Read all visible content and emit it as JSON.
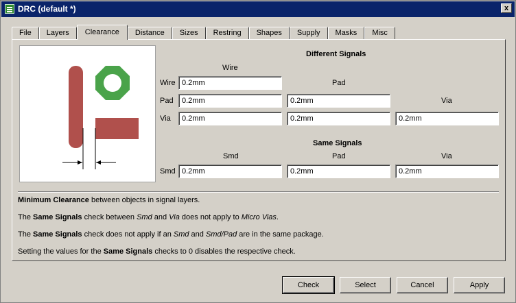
{
  "window": {
    "title": "DRC (default *)",
    "close_symbol": "x"
  },
  "tabs": [
    "File",
    "Layers",
    "Clearance",
    "Distance",
    "Sizes",
    "Restring",
    "Shapes",
    "Supply",
    "Masks",
    "Misc"
  ],
  "active_tab": "Clearance",
  "different_signals": {
    "heading": "Different Signals",
    "col_wire": "Wire",
    "col_pad": "Pad",
    "col_via": "Via",
    "row_wire": "Wire",
    "row_pad": "Pad",
    "row_via": "Via",
    "wire_wire": "0.2mm",
    "pad_wire": "0.2mm",
    "pad_pad": "0.2mm",
    "via_wire": "0.2mm",
    "via_pad": "0.2mm",
    "via_via": "0.2mm"
  },
  "same_signals": {
    "heading": "Same Signals",
    "col_smd": "Smd",
    "col_pad": "Pad",
    "col_via": "Via",
    "row_smd": "Smd",
    "smd_smd": "0.2mm",
    "smd_pad": "0.2mm",
    "smd_via": "0.2mm"
  },
  "description": {
    "line1_b": "Minimum Clearance",
    "line1_t": " between objects in signal layers.",
    "line2_a": "The ",
    "line2_b": "Same Signals",
    "line2_c": " check between ",
    "line2_i1": "Smd",
    "line2_d": " and ",
    "line2_i2": "Via",
    "line2_e": " does not apply to ",
    "line2_i3": "Micro Vias",
    "line2_f": ".",
    "line3_a": "The ",
    "line3_b": "Same Signals",
    "line3_c": " check does not apply if an ",
    "line3_i1": "Smd",
    "line3_d": " and ",
    "line3_i2": "Smd/Pad",
    "line3_e": " are in the same package.",
    "line4_a": "Setting the values for the ",
    "line4_b": "Same Signals",
    "line4_c": " checks to 0 disables the respective check."
  },
  "buttons": {
    "check": "Check",
    "select": "Select",
    "cancel": "Cancel",
    "apply": "Apply"
  },
  "colors": {
    "wire": "#b0504c",
    "pad": "#4aa34a",
    "titlebar": "#0a246a"
  }
}
